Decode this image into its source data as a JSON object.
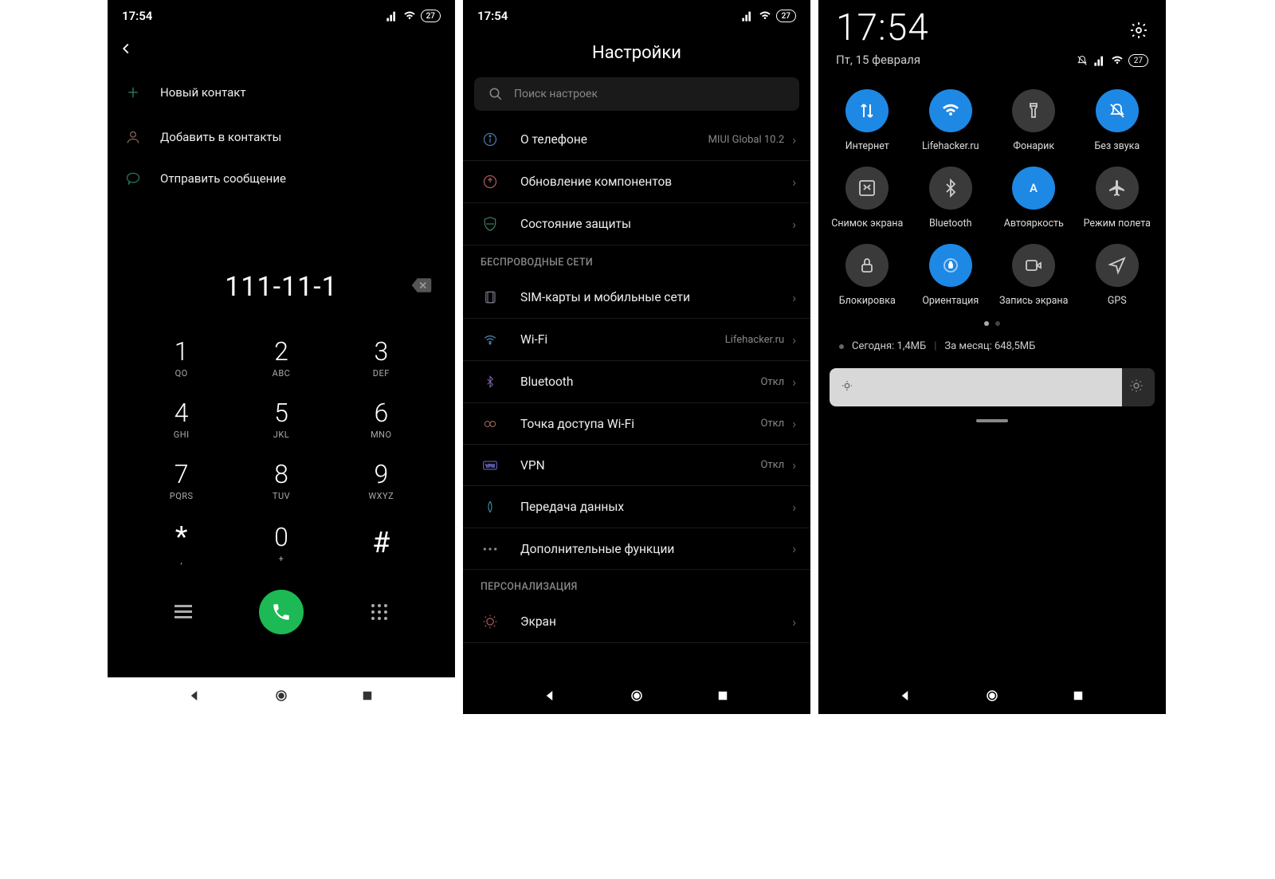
{
  "statusbar": {
    "time": "17:54",
    "battery": "27"
  },
  "dialer": {
    "actions": {
      "new_contact": "Новый контакт",
      "add_to_contacts": "Добавить в контакты",
      "send_message": "Отправить сообщение"
    },
    "number": "111-11-1",
    "keys": [
      {
        "d": "1",
        "l": "QO"
      },
      {
        "d": "2",
        "l": "ABC"
      },
      {
        "d": "3",
        "l": "DEF"
      },
      {
        "d": "4",
        "l": "GHI"
      },
      {
        "d": "5",
        "l": "JKL"
      },
      {
        "d": "6",
        "l": "MNO"
      },
      {
        "d": "7",
        "l": "PQRS"
      },
      {
        "d": "8",
        "l": "TUV"
      },
      {
        "d": "9",
        "l": "WXYZ"
      },
      {
        "d": "*",
        "l": ","
      },
      {
        "d": "0",
        "l": "+"
      },
      {
        "d": "#",
        "l": ""
      }
    ]
  },
  "settings": {
    "title": "Настройки",
    "search_placeholder": "Поиск настроек",
    "about_label": "О телефоне",
    "about_value": "MIUI Global 10.2",
    "update_label": "Обновление компонентов",
    "security_label": "Состояние защиты",
    "section_wireless": "БЕСПРОВОДНЫЕ СЕТИ",
    "sim_label": "SIM-карты и мобильные сети",
    "wifi_label": "Wi-Fi",
    "wifi_value": "Lifehacker.ru",
    "bt_label": "Bluetooth",
    "bt_value": "Откл",
    "hotspot_label": "Точка доступа Wi-Fi",
    "hotspot_value": "Откл",
    "vpn_label": "VPN",
    "vpn_value": "Откл",
    "data_label": "Передача данных",
    "more_label": "Дополнительные функции",
    "section_personal": "ПЕРСОНАЛИЗАЦИЯ",
    "display_label": "Экран"
  },
  "qs": {
    "time": "17:54",
    "date": "Пт, 15 февраля",
    "battery": "27",
    "tiles": {
      "internet": "Интернет",
      "wifi": "Lifehacker.ru",
      "flashlight": "Фонарик",
      "mute": "Без звука",
      "screenshot": "Снимок экрана",
      "bluetooth": "Bluetooth",
      "autobrightness": "Автояркость",
      "airplane": "Режим полета",
      "lock": "Блокировка",
      "orientation": "Ориентация",
      "record": "Запись экрана",
      "gps": "GPS"
    },
    "usage_today": "Сегодня: 1,4МБ",
    "usage_month": "За месяц: 648,5МБ"
  }
}
